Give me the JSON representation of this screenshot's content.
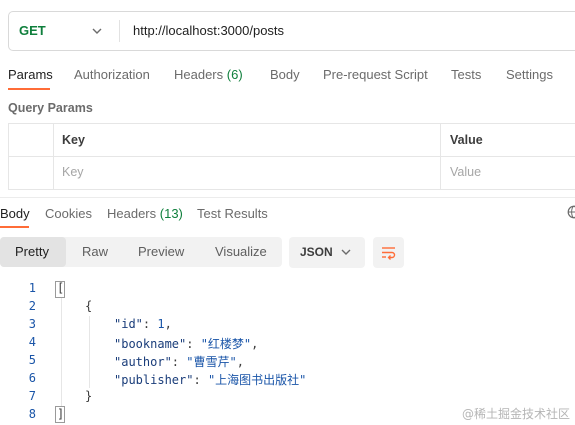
{
  "request": {
    "method": "GET",
    "url": "http://localhost:3000/posts"
  },
  "request_tabs": {
    "params": "Params",
    "authorization": "Authorization",
    "headers": "Headers",
    "headers_count": "(6)",
    "body": "Body",
    "prerequest": "Pre-request Script",
    "tests": "Tests",
    "settings": "Settings"
  },
  "query_params": {
    "title": "Query Params",
    "columns": {
      "key": "Key",
      "value": "Value"
    },
    "placeholders": {
      "key": "Key",
      "value": "Value"
    }
  },
  "response_tabs": {
    "body": "Body",
    "cookies": "Cookies",
    "headers": "Headers",
    "headers_count": "(13)",
    "test_results": "Test Results"
  },
  "view_modes": {
    "pretty": "Pretty",
    "raw": "Raw",
    "preview": "Preview",
    "visualize": "Visualize",
    "selected": "Pretty"
  },
  "format": {
    "selected": "JSON"
  },
  "code": {
    "line_numbers": [
      "1",
      "2",
      "3",
      "4",
      "5",
      "6",
      "7",
      "8"
    ],
    "open_array": "[",
    "open_obj": "{",
    "k_id": "\"id\"",
    "v_id": "1",
    "k_bookname": "\"bookname\"",
    "v_bookname": "\"红楼梦\"",
    "k_author": "\"author\"",
    "v_author": "\"曹雪芹\"",
    "k_publisher": "\"publisher\"",
    "v_publisher": "\"上海图书出版社\"",
    "close_obj": "}",
    "close_array": "]"
  },
  "watermark": "@稀土掘金技术社区",
  "colors": {
    "accent": "#ff6c37",
    "method_get": "#0f7f3c",
    "count_green": "#0f7f3c"
  }
}
